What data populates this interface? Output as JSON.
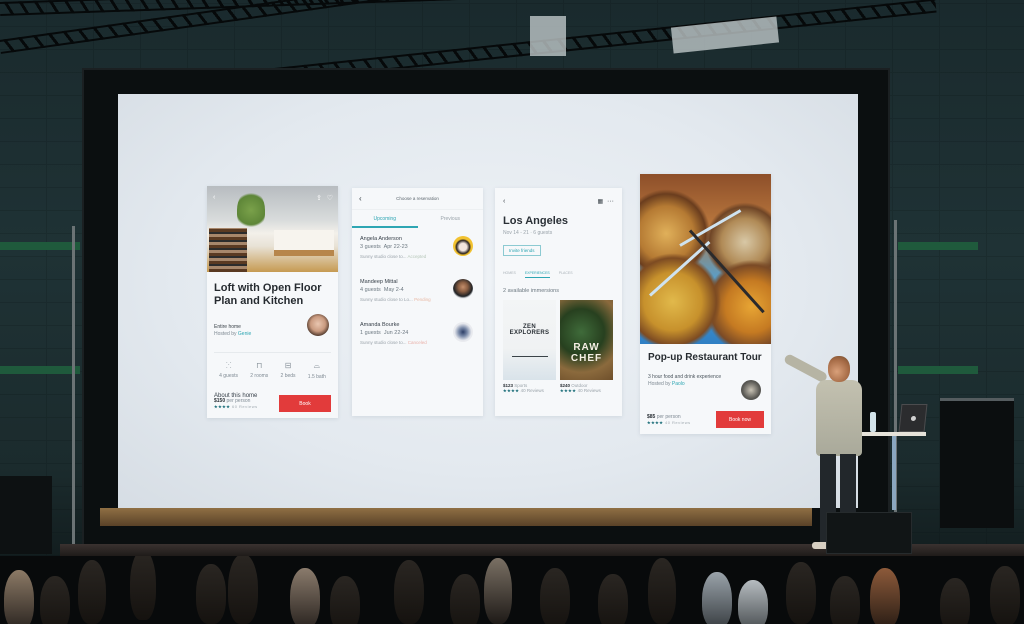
{
  "scene": {
    "description": "Presenter on stage pointing at projected app mockups",
    "colors": {
      "accent_teal": "#2ea6b3",
      "button_red": "#e23b3b",
      "screen_bg": "#e8edf2"
    }
  },
  "cards": {
    "listing": {
      "icons": {
        "back": "chevron-left-icon",
        "share": "share-icon",
        "favorite": "heart-icon"
      },
      "title": "Loft with Open Floor Plan and Kitchen",
      "type": "Entire home",
      "hosted_by_label": "Hosted by",
      "host_name": "Genie",
      "amenities": [
        {
          "icon": "people-icon",
          "label": "4 guests"
        },
        {
          "icon": "door-icon",
          "label": "2 rooms"
        },
        {
          "icon": "bed-icon",
          "label": "2 beds"
        },
        {
          "icon": "bath-icon",
          "label": "1.5 bath"
        }
      ],
      "section_title": "About this home",
      "price": "$150",
      "price_unit": "per person",
      "rating_stars": "★★★★",
      "reviews": "60 Reviews",
      "book_label": "Book"
    },
    "reservations": {
      "header_title": "Choose a reservation",
      "tabs": [
        {
          "label": "Upcoming",
          "active": true
        },
        {
          "label": "Previous",
          "active": false
        }
      ],
      "items": [
        {
          "name": "Angela Anderson",
          "guests": "3 guests",
          "dates": "Apr 22-23",
          "desc": "Sunny studio close to...",
          "status": "Accepted"
        },
        {
          "name": "Mandeep Mittal",
          "guests": "4 guests",
          "dates": "May 2-4",
          "desc": "Sunny studio close to Lo...",
          "status": "Pending"
        },
        {
          "name": "Amanda Bourke",
          "guests": "1 guests",
          "dates": "Jun 22-24",
          "desc": "Sunny studio close to...",
          "status": "Canceled"
        }
      ]
    },
    "trip": {
      "city": "Los Angeles",
      "dates": "Nov 14 - 21 · 6 guests",
      "invite_label": "Invite friends",
      "subtabs": [
        {
          "label": "HOMES",
          "active": false
        },
        {
          "label": "EXPERIENCES",
          "active": true
        },
        {
          "label": "PLACES",
          "active": false
        }
      ],
      "available": "2 available immersions",
      "experiences": [
        {
          "poster_title": "ZEN EXPLORERS",
          "price": "$123",
          "category": "Sports",
          "stars": "★★★★",
          "reviews": "40 Reviews"
        },
        {
          "poster_title": "RAW CHEF",
          "price": "$240",
          "category": "Outdoor",
          "stars": "★★★★",
          "reviews": "40 Reviews"
        }
      ]
    },
    "experience": {
      "title": "Pop-up Restaurant Tour",
      "subtitle": "3 hour food and drink experience",
      "hosted_by_label": "Hosted by",
      "host_name": "Paolo",
      "price": "$85",
      "price_unit": "per person",
      "rating_stars": "★★★★",
      "reviews": "40 Reviews",
      "book_label": "Book now"
    }
  }
}
